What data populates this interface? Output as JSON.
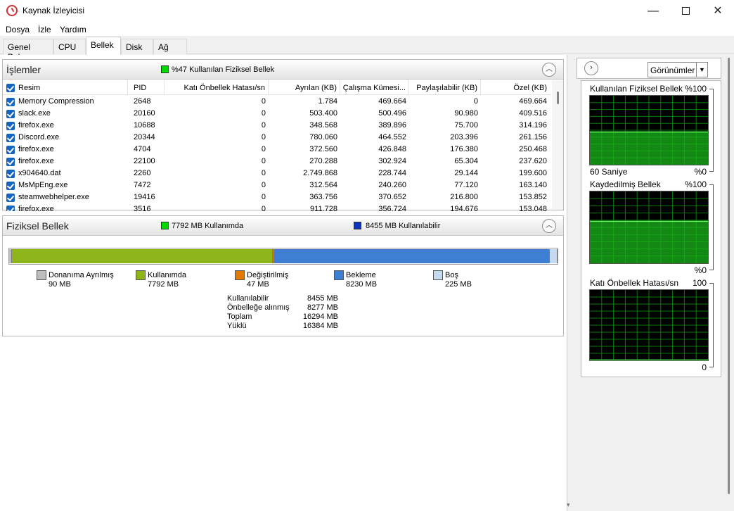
{
  "window": {
    "title": "Kaynak İzleyicisi",
    "min": "—",
    "close": "✕"
  },
  "menu": [
    "Dosya",
    "İzle",
    "Yardım"
  ],
  "tabs": [
    "Genel Bakış",
    "CPU",
    "Bellek",
    "Disk",
    "Ağ"
  ],
  "processes": {
    "title": "İşlemler",
    "summary": "%47 Kullanılan Fiziksel Bellek",
    "summary_color": "#00d800",
    "columns": [
      "Resim",
      "PID",
      "Katı Önbellek Hatası/sn",
      "Ayrılan (KB)",
      "Çalışma Kümesi...",
      "Paylaşılabilir (KB)",
      "Özel (KB)"
    ],
    "rows": [
      [
        "Memory Compression",
        "2648",
        "0",
        "1.784",
        "469.664",
        "0",
        "469.664"
      ],
      [
        "slack.exe",
        "20160",
        "0",
        "503.400",
        "500.496",
        "90.980",
        "409.516"
      ],
      [
        "firefox.exe",
        "10688",
        "0",
        "348.568",
        "389.896",
        "75.700",
        "314.196"
      ],
      [
        "Discord.exe",
        "20344",
        "0",
        "780.060",
        "464.552",
        "203.396",
        "261.156"
      ],
      [
        "firefox.exe",
        "4704",
        "0",
        "372.560",
        "426.848",
        "176.380",
        "250.468"
      ],
      [
        "firefox.exe",
        "22100",
        "0",
        "270.288",
        "302.924",
        "65.304",
        "237.620"
      ],
      [
        "x904640.dat",
        "2260",
        "0",
        "2.749.868",
        "228.744",
        "29.144",
        "199.600"
      ],
      [
        "MsMpEng.exe",
        "7472",
        "0",
        "312.564",
        "240.260",
        "77.120",
        "163.140"
      ],
      [
        "steamwebhelper.exe",
        "19416",
        "0",
        "363.756",
        "370.652",
        "216.800",
        "153.852"
      ],
      [
        "firefox.exe",
        "3516",
        "0",
        "911.728",
        "356.724",
        "194.676",
        "153.048"
      ]
    ]
  },
  "physical": {
    "title": "Fiziksel Bellek",
    "in_use": "7792 MB Kullanımda",
    "in_use_color": "#00d800",
    "available": "8455 MB Kullanılabilir",
    "available_color": "#1133bb",
    "bar": [
      {
        "name": "Donanıma Ayrılmış",
        "mb": 90,
        "color": "#bdbdbd"
      },
      {
        "name": "Kullanımda",
        "mb": 7792,
        "color": "#8eb51a"
      },
      {
        "name": "Değiştirilmiş",
        "mb": 47,
        "color": "#e07b00"
      },
      {
        "name": "Bekleme",
        "mb": 8230,
        "color": "#3e7fd4"
      },
      {
        "name": "Boş",
        "mb": 225,
        "color": "#c5d9f1"
      }
    ],
    "legend": [
      {
        "name": "Donanıma Ayrılmış",
        "value": "90 MB",
        "color": "#bdbdbd"
      },
      {
        "name": "Kullanımda",
        "value": "7792 MB",
        "color": "#8eb51a"
      },
      {
        "name": "Değiştirilmiş",
        "value": "47 MB",
        "color": "#e07b00"
      },
      {
        "name": "Bekleme",
        "value": "8230 MB",
        "color": "#3e7fd4"
      },
      {
        "name": "Boş",
        "value": "225 MB",
        "color": "#c5d9f1"
      }
    ],
    "stats": [
      {
        "label": "Kullanılabilir",
        "value": "8455 MB"
      },
      {
        "label": "Önbelleğe alınmış",
        "value": "8277 MB"
      },
      {
        "label": "Toplam",
        "value": "16294 MB"
      },
      {
        "label": "Yüklü",
        "value": "16384 MB"
      }
    ]
  },
  "right": {
    "dropdown": "Görünümler",
    "graphs": [
      {
        "title": "Kullanılan Fiziksel Bellek",
        "max": "%100",
        "bottom_left": "60 Saniye",
        "bottom_right": "%0",
        "level": 0.47
      },
      {
        "title": "Kaydedilmiş Bellek",
        "max": "%100",
        "bottom_left": "",
        "bottom_right": "%0",
        "level": 0.58
      },
      {
        "title": "Katı Önbellek Hatası/sn",
        "max": "100",
        "bottom_left": "",
        "bottom_right": "0",
        "level": 0.0
      }
    ]
  }
}
